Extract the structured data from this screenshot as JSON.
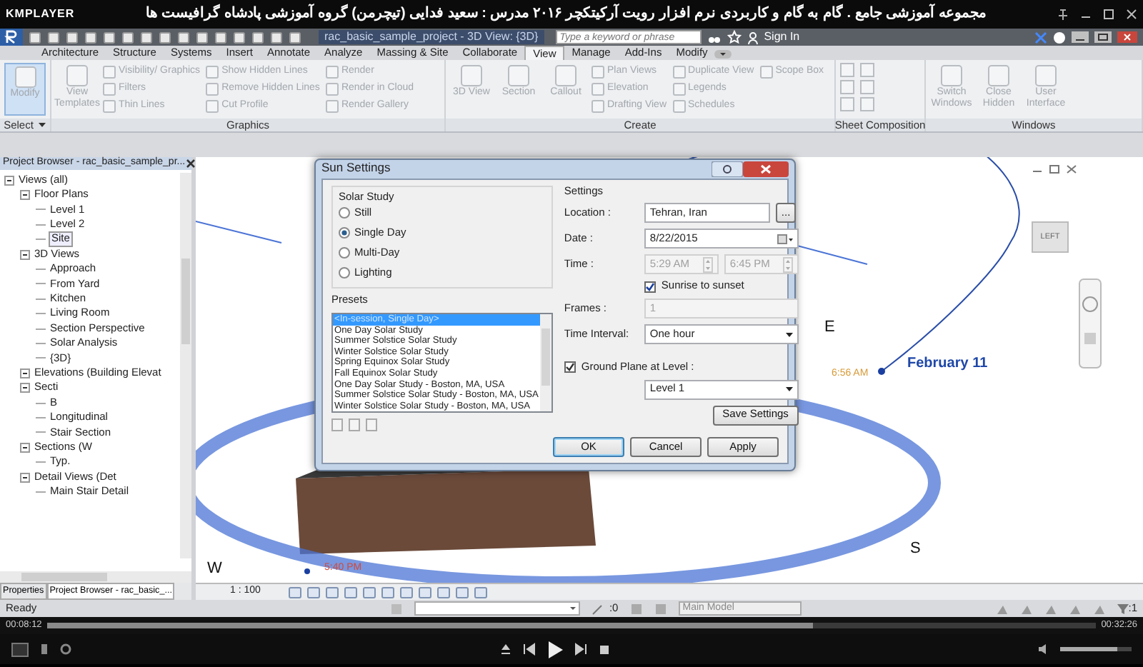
{
  "player": {
    "brand": "KMPLAYER",
    "title": "مجموعه آموزشی جامع . گام به گام و کاربردی نرم افزار رویت آرکیتکچر ۲۰۱۶   مدرس : سعید فدایی (تیچرمن) گروه آموزشی پادشاه گرافیست ها"
  },
  "app": {
    "document_title": "rac_basic_sample_project - 3D View: {3D}",
    "search": {
      "placeholder": "Type a keyword or phrase"
    },
    "sign_in": "Sign In"
  },
  "ribbon_tabs": [
    {
      "label": "Architecture",
      "selected": false
    },
    {
      "label": "Structure",
      "selected": false
    },
    {
      "label": "Systems",
      "selected": false
    },
    {
      "label": "Insert",
      "selected": false
    },
    {
      "label": "Annotate",
      "selected": false
    },
    {
      "label": "Analyze",
      "selected": false
    },
    {
      "label": "Massing & Site",
      "selected": false
    },
    {
      "label": "Collaborate",
      "selected": false
    },
    {
      "label": "View",
      "selected": true
    },
    {
      "label": "Manage",
      "selected": false
    },
    {
      "label": "Add-Ins",
      "selected": false
    },
    {
      "label": "Modify",
      "selected": false
    }
  ],
  "ribbon_panels": [
    {
      "title": "Select",
      "items": [
        {
          "label": "Modify",
          "kind": "large",
          "selected": true
        }
      ]
    },
    {
      "title": "Graphics",
      "items": [
        {
          "label": "View Templates",
          "kind": "large",
          "selected": false
        },
        {
          "label": "Visibility/ Graphics",
          "kind": "small",
          "selected": false
        },
        {
          "label": "Filters",
          "kind": "small",
          "selected": false
        },
        {
          "label": "Thin Lines",
          "kind": "small",
          "selected": false
        },
        {
          "label": "Show Hidden Lines",
          "kind": "small",
          "selected": false
        },
        {
          "label": "Remove Hidden Lines",
          "kind": "small",
          "selected": false
        },
        {
          "label": "Cut Profile",
          "kind": "small",
          "selected": false
        },
        {
          "label": "Render",
          "kind": "small",
          "selected": false
        },
        {
          "label": "Render in Cloud",
          "kind": "small",
          "selected": false
        },
        {
          "label": "Render Gallery",
          "kind": "small",
          "selected": false
        }
      ]
    },
    {
      "title": "Create",
      "items": [
        {
          "label": "3D View",
          "kind": "large",
          "selected": false
        },
        {
          "label": "Section",
          "kind": "large",
          "selected": false
        },
        {
          "label": "Callout",
          "kind": "large",
          "selected": false
        },
        {
          "label": "Plan Views",
          "kind": "small",
          "selected": false
        },
        {
          "label": "Elevation",
          "kind": "small",
          "selected": false
        },
        {
          "label": "Drafting View",
          "kind": "small",
          "selected": false
        },
        {
          "label": "Duplicate View",
          "kind": "small",
          "selected": false
        },
        {
          "label": "Legends",
          "kind": "small",
          "selected": false
        },
        {
          "label": "Schedules",
          "kind": "small",
          "selected": false
        },
        {
          "label": "Scope Box",
          "kind": "small",
          "selected": false
        }
      ]
    },
    {
      "title": "Sheet Composition"
    },
    {
      "title": "Windows",
      "items": [
        {
          "label": "Switch Windows",
          "kind": "large",
          "selected": false
        },
        {
          "label": "Close Hidden",
          "kind": "large",
          "selected": false
        },
        {
          "label": "User Interface",
          "kind": "large",
          "selected": false
        }
      ]
    }
  ],
  "project_browser": {
    "title": "Project Browser - rac_basic_sample_pr...",
    "tree": [
      {
        "label": "Views (all)",
        "expanded": true,
        "selected": false,
        "children": [
          {
            "label": "Floor Plans",
            "expanded": true,
            "selected": false,
            "children": [
              {
                "label": "Level 1",
                "selected": false
              },
              {
                "label": "Level 2",
                "selected": false
              },
              {
                "label": "Site",
                "selected": true
              }
            ]
          },
          {
            "label": "3D Views",
            "expanded": true,
            "selected": false,
            "children": [
              {
                "label": "Approach",
                "selected": false
              },
              {
                "label": "From Yard",
                "selected": false
              },
              {
                "label": "Kitchen",
                "selected": false
              },
              {
                "label": "Living Room",
                "selected": false
              },
              {
                "label": "Section Perspective",
                "selected": false
              },
              {
                "label": "Solar Analysis",
                "selected": false
              },
              {
                "label": "{3D}",
                "selected": false
              }
            ]
          },
          {
            "label": "Elevations (Building Elevat",
            "expanded": true,
            "selected": false
          },
          {
            "label": "Secti",
            "expanded": true,
            "selected": false,
            "children": [
              {
                "label": "B",
                "selected": false
              },
              {
                "label": "Longitudinal",
                "selected": false
              },
              {
                "label": "Stair Section",
                "selected": false
              }
            ]
          },
          {
            "label": "Sections (W",
            "expanded": true,
            "selected": false,
            "children": [
              {
                "label": "Typ.",
                "selected": false
              }
            ]
          },
          {
            "label": "Detail Views (Det",
            "expanded": true,
            "selected": false,
            "children": [
              {
                "label": "Main Stair Detail",
                "selected": false
              }
            ]
          }
        ]
      }
    ],
    "tabs": [
      {
        "label": "Properties",
        "selected": false
      },
      {
        "label": "Project Browser - rac_basic_...",
        "selected": true
      }
    ]
  },
  "viewport": {
    "scale": "1 : 100",
    "view_cube": "LEFT",
    "labels": [
      {
        "text": "E",
        "kind": "compass"
      },
      {
        "text": "February 11",
        "kind": "date"
      },
      {
        "text": "6:56 AM",
        "kind": "sunrise"
      },
      {
        "text": "S",
        "kind": "compass"
      },
      {
        "text": "W",
        "kind": "compass"
      },
      {
        "text": "5:40 PM",
        "kind": "sunset"
      }
    ]
  },
  "sun_settings": {
    "title": "Sun Settings",
    "solar_study": {
      "title": "Solar Study",
      "options": [
        {
          "label": "Still",
          "selected": false
        },
        {
          "label": "Single Day",
          "selected": true
        },
        {
          "label": "Multi-Day",
          "selected": false
        },
        {
          "label": "Lighting",
          "selected": false
        }
      ]
    },
    "presets": {
      "title": "Presets",
      "items": [
        {
          "label": "<In-session, Single Day>",
          "selected": true
        },
        {
          "label": "One Day Solar Study",
          "selected": false
        },
        {
          "label": "Summer Solstice Solar Study",
          "selected": false
        },
        {
          "label": "Winter Solstice Solar Study",
          "selected": false
        },
        {
          "label": "Spring Equinox Solar Study",
          "selected": false
        },
        {
          "label": "Fall Equinox Solar Study",
          "selected": false
        },
        {
          "label": "One Day Solar Study - Boston, MA, USA",
          "selected": false
        },
        {
          "label": "Summer Solstice Solar Study - Boston, MA, USA",
          "selected": false
        },
        {
          "label": "Winter Solstice Solar Study - Boston, MA, USA",
          "selected": false
        }
      ]
    },
    "settings": {
      "title": "Settings",
      "location": {
        "label": "Location :",
        "value": "Tehran, Iran",
        "browse": "..."
      },
      "date": {
        "label": "Date :",
        "value": "8/22/2015"
      },
      "time": {
        "label": "Time :",
        "start": "5:29 AM",
        "end": "6:45 PM",
        "disabled": true
      },
      "sunrise_to_sunset": {
        "label": "Sunrise to sunset",
        "checked": true
      },
      "frames": {
        "label": "Frames :",
        "value": "1",
        "disabled": true
      },
      "time_interval": {
        "label": "Time Interval:",
        "value": "One hour"
      },
      "ground_plane": {
        "label": "Ground Plane at Level :",
        "checked": true,
        "value": "Level 1"
      },
      "save": "Save Settings"
    },
    "buttons": [
      {
        "label": "OK",
        "default": true
      },
      {
        "label": "Cancel",
        "default": false
      },
      {
        "label": "Apply",
        "default": false
      }
    ]
  },
  "status_bar": {
    "text": "Ready",
    "count": ":0",
    "model": "Main Model",
    "filter_count": ":1"
  },
  "playback": {
    "elapsed": "00:08:12",
    "total": "00:32:26",
    "progress": {
      "level": 0.73
    },
    "volume": {
      "level": 0.8
    }
  }
}
